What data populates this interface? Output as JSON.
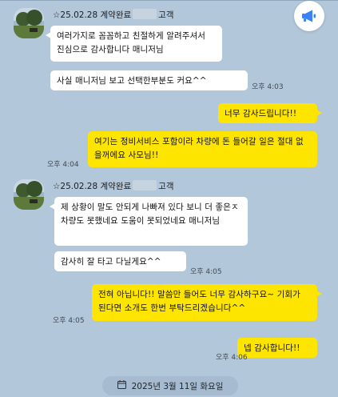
{
  "chat": {
    "groups": [
      {
        "sender_prefix": "☆25.02.28 계약완료",
        "sender_suffix": "고객",
        "messages": [
          {
            "text": "여러가지로 꼼꼼하고 친절하게 알려주셔서 진심으로 감사합니다 매니저님"
          },
          {
            "text": "사실 매니저님 보고 선택한부분도 커요^^",
            "time": "오후 4:03"
          }
        ]
      },
      {
        "outgoing": [
          {
            "text": "너무 감사드립니다!!"
          },
          {
            "text": "여기는 정비서비스 포함이라 차량에 돈 들어갈 일은 절대 없을꺼에요 사모님!!",
            "time": "오후 4:04"
          }
        ]
      },
      {
        "sender_prefix": "☆25.02.28 계약완료",
        "sender_suffix": "고객",
        "messages": [
          {
            "text": "제 상황이 말도 안되게 나빠져 있다 보니 더  좋은ㅈ차량도 못했네요   도움이 못되었네요 매니저님"
          },
          {
            "text": "감사히 잘 타고 다닐게요^^",
            "time": "오후 4:05"
          }
        ]
      },
      {
        "outgoing": [
          {
            "text": "전혀 아닙니다!! 말씀만 들어도 너무 감사하구요~ 기회가 된다면 소개도 한번 부탁드리겠습니다^^",
            "time": "오후 4:05"
          },
          {
            "text": "넵 감사합니다!!",
            "time": "오후 4:06"
          }
        ]
      }
    ],
    "date_divider": "2025년 3월 11일 화요일"
  },
  "icons": {
    "announce": "megaphone-icon",
    "calendar": "calendar-icon"
  },
  "colors": {
    "background": "#b2c7da",
    "outgoing_bubble": "#fee500",
    "incoming_bubble": "#ffffff",
    "accent": "#3b82f6"
  }
}
